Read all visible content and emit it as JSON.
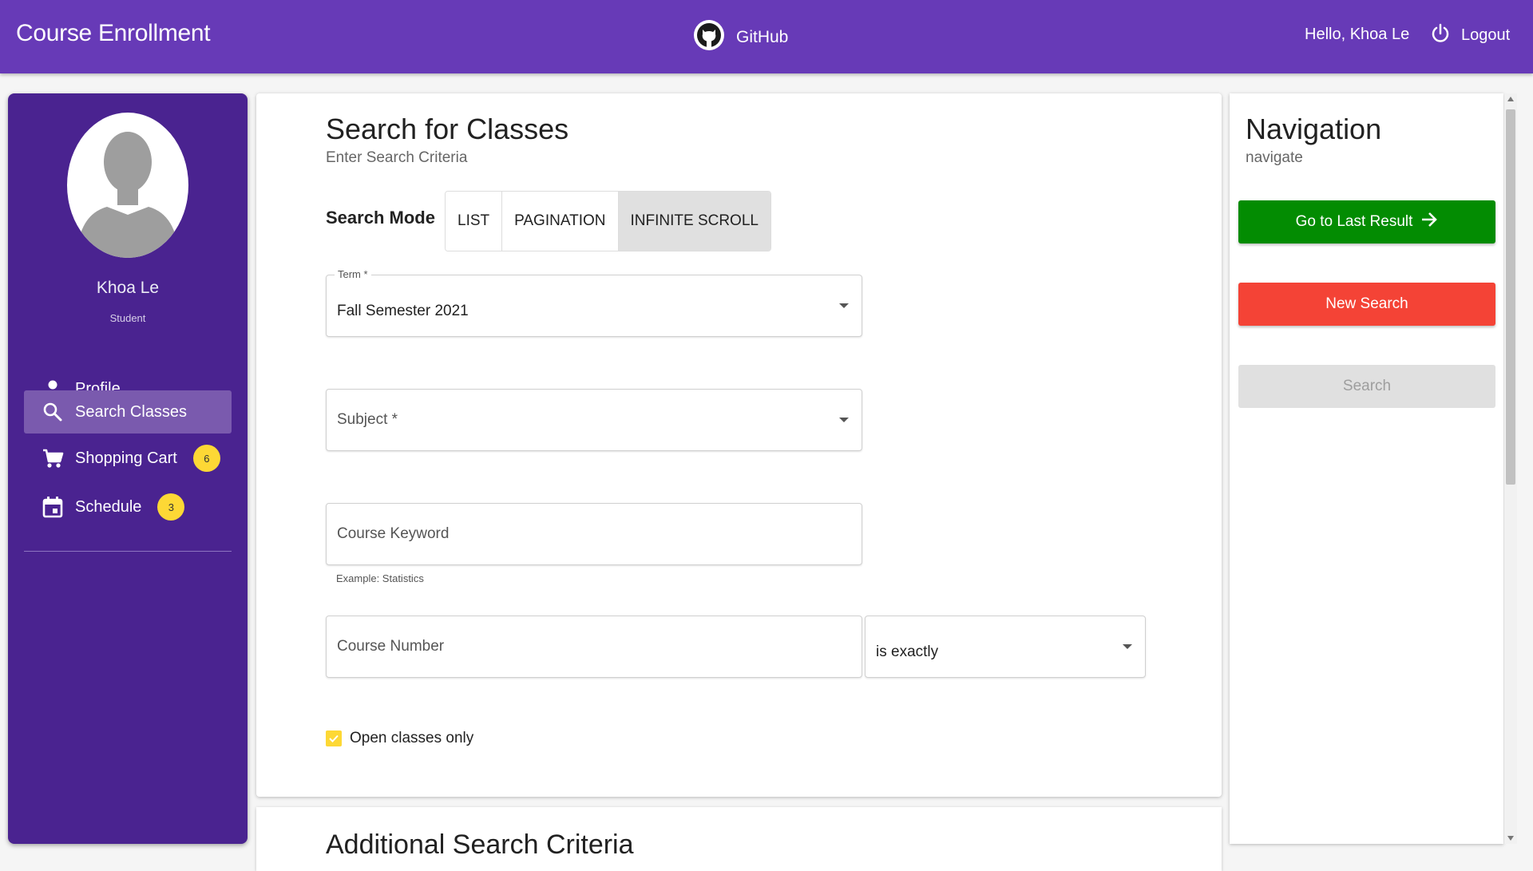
{
  "header": {
    "app_title": "Course Enrollment",
    "github_label": "GitHub",
    "greeting": "Hello, Khoa Le",
    "logout_label": "Logout"
  },
  "sidebar": {
    "user_name": "Khoa Le",
    "user_role": "Student",
    "items": [
      {
        "label": "Profile",
        "icon": "person-icon",
        "active": false
      },
      {
        "label": "Search Classes",
        "icon": "search-icon",
        "active": true
      },
      {
        "label": "Shopping Cart",
        "icon": "cart-icon",
        "badge": "6"
      },
      {
        "label": "Schedule",
        "icon": "calendar-icon",
        "badge": "3"
      }
    ]
  },
  "main": {
    "title": "Search for Classes",
    "subtitle": "Enter Search Criteria",
    "search_mode_label": "Search Mode",
    "modes": [
      "LIST",
      "PAGINATION",
      "INFINITE SCROLL"
    ],
    "selected_mode": "INFINITE SCROLL",
    "term": {
      "legend": "Term *",
      "value": "Fall Semester 2021"
    },
    "subject": {
      "placeholder": "Subject *"
    },
    "keyword": {
      "placeholder": "Course Keyword",
      "helper": "Example: Statistics"
    },
    "course_number": {
      "placeholder": "Course Number"
    },
    "operator": {
      "value": "is exactly"
    },
    "open_only": {
      "label": "Open classes only",
      "checked": true
    },
    "additional_title": "Additional Search Criteria"
  },
  "navigation": {
    "title": "Navigation",
    "subtitle": "navigate",
    "go_last": "Go to Last Result",
    "new_search": "New Search",
    "search": "Search"
  },
  "colors": {
    "appbar": "#673ab7",
    "sidebar": "#4a2390",
    "green": "#038c02",
    "red": "#f44336",
    "badge": "#fdd835"
  }
}
